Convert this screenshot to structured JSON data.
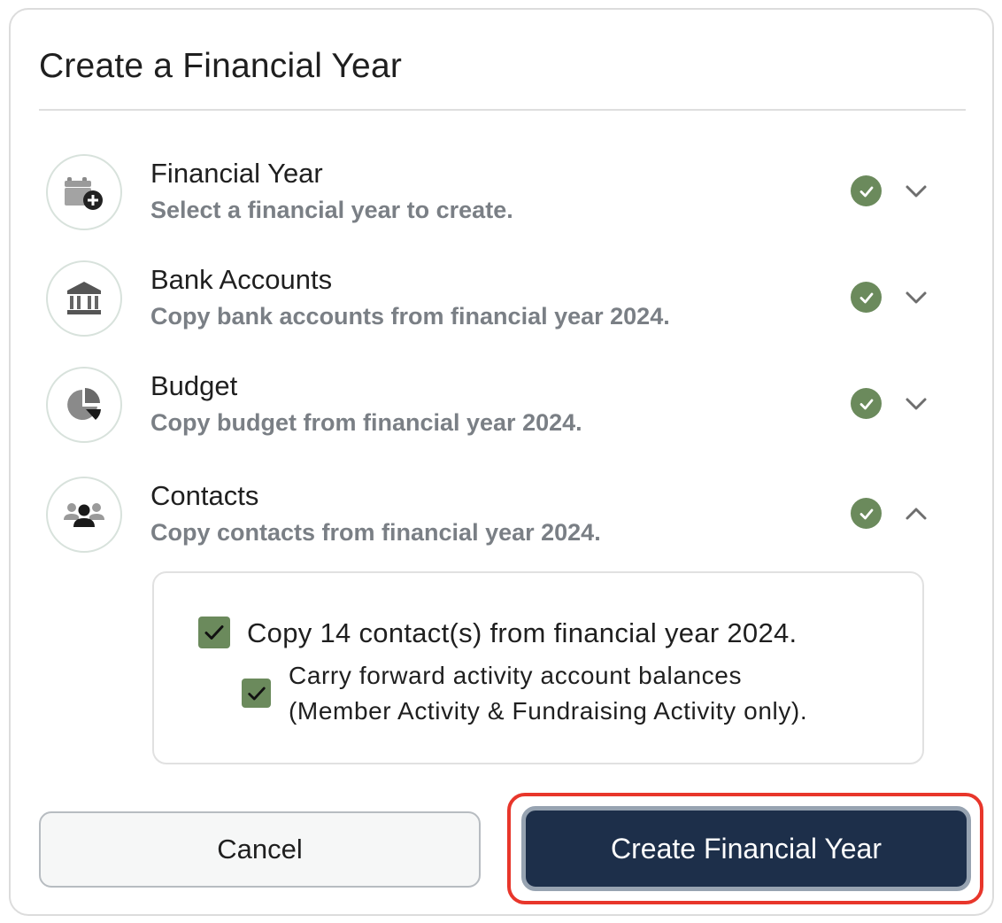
{
  "dialog": {
    "title": "Create a Financial Year"
  },
  "steps": [
    {
      "title": "Financial Year",
      "subtitle": "Select a financial year to create.",
      "icon": "calendar-plus-icon",
      "status": "complete",
      "expanded": false
    },
    {
      "title": "Bank Accounts",
      "subtitle": "Copy bank accounts from financial year 2024.",
      "icon": "bank-icon",
      "status": "complete",
      "expanded": false
    },
    {
      "title": "Budget",
      "subtitle": "Copy budget from financial year 2024.",
      "icon": "pie-chart-icon",
      "status": "complete",
      "expanded": false
    },
    {
      "title": "Contacts",
      "subtitle": "Copy contacts from financial year 2024.",
      "icon": "users-icon",
      "status": "complete",
      "expanded": true
    }
  ],
  "contacts_panel": {
    "copy_contacts": {
      "label": "Copy 14 contact(s) from financial year 2024.",
      "checked": true
    },
    "carry_forward": {
      "label_line1": "Carry forward activity account balances",
      "label_line2": "(Member Activity & Fundraising Activity only).",
      "checked": true
    }
  },
  "actions": {
    "cancel_label": "Cancel",
    "create_label": "Create Financial Year"
  },
  "colors": {
    "accent_green": "#6b8a5c",
    "primary_navy": "#1d2f4a",
    "highlight_red": "#e8362b"
  }
}
